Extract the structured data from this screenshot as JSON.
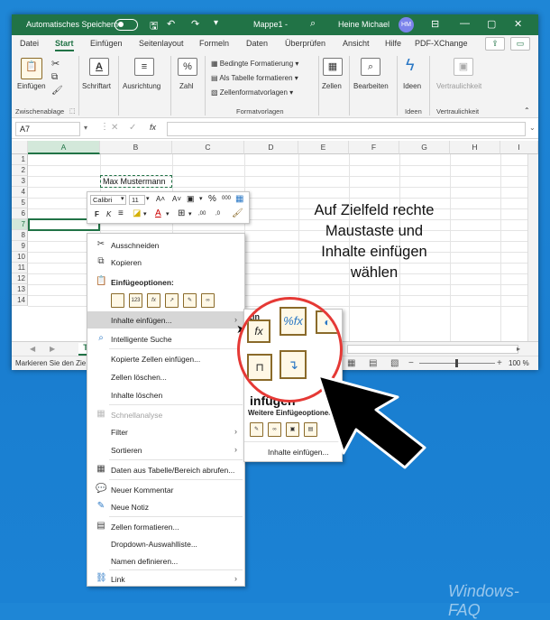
{
  "titlebar": {
    "autosave_label": "Automatisches Speichern",
    "file_name": "Mappe1",
    "separator": "-",
    "user_name": "Heine Michael",
    "avatar_initials": "HM"
  },
  "ribbon_tabs": [
    "Datei",
    "Start",
    "Einfügen",
    "Seitenlayout",
    "Formeln",
    "Daten",
    "Überprüfen",
    "Ansicht",
    "Hilfe",
    "PDF-XChange"
  ],
  "ribbon": {
    "paste_label": "Einfügen",
    "clipboard_group": "Zwischenablage",
    "font_label": "Schriftart",
    "align_label": "Ausrichtung",
    "number_label": "Zahl",
    "number_icon": "%",
    "cond_format": "Bedingte Formatierung",
    "as_table": "Als Tabelle formatieren",
    "cell_styles": "Zellenformatvorlagen",
    "styles_group": "Formatvorlagen",
    "cells_label": "Zellen",
    "edit_label": "Bearbeiten",
    "ideas_label": "Ideen",
    "ideas_group": "Ideen",
    "sensitivity_label": "Vertraulichkeit",
    "sensitivity_group": "Vertraulichkeit"
  },
  "formula_bar": {
    "namebox": "A7",
    "fx": "fx"
  },
  "columns": [
    "A",
    "B",
    "C",
    "D",
    "E",
    "F",
    "G",
    "H",
    "I"
  ],
  "rows": [
    "1",
    "2",
    "3",
    "4",
    "5",
    "6",
    "7",
    "8",
    "9",
    "10",
    "11",
    "12",
    "13",
    "14"
  ],
  "cells": {
    "b3": "Max Mustermann"
  },
  "sheet_tab_partial": "T",
  "status": {
    "text": "Markieren Sie den Zie",
    "zoom": "100 %"
  },
  "mini_toolbar": {
    "font": "Calibri",
    "size": "11",
    "bold": "F",
    "italic": "K",
    "increase_font": "A˄",
    "decrease_font": "A˅",
    "percent": "%",
    "thousands": "000",
    "inc_decimal": ",00",
    "dec_decimal": ",0"
  },
  "context_menu": {
    "cut": "Ausschneiden",
    "copy": "Kopieren",
    "paste_options": "Einfügeoptionen:",
    "paste_special": "Inhalte einfügen...",
    "smart_lookup": "Intelligente Suche",
    "insert_copied": "Kopierte Zellen einfügen...",
    "delete_cells": "Zellen löschen...",
    "clear_contents": "Inhalte löschen",
    "quick_analysis": "Schnellanalyse",
    "filter": "Filter",
    "sort": "Sortieren",
    "get_data": "Daten aus Tabelle/Bereich abrufen...",
    "new_comment": "Neuer Kommentar",
    "new_note": "Neue Notiz",
    "format_cells": "Zellen formatieren...",
    "dropdown_list": "Dropdown-Auswahlliste...",
    "define_names": "Namen definieren...",
    "link": "Link"
  },
  "submenu": {
    "header": "Ein",
    "paste_big": "infügen",
    "more_options": "Weitere Einfügeoptionen",
    "paste_special": "Inhalte einfügen..."
  },
  "annotation": {
    "line1": "Auf Zielfeld rechte",
    "line2": "Maustaste und",
    "line3": "Inhalte einfügen",
    "line4": "wählen"
  },
  "watermark": "Windows-FAQ",
  "colors": {
    "excel_green": "#217346",
    "magnifier_ring": "#e53935"
  }
}
